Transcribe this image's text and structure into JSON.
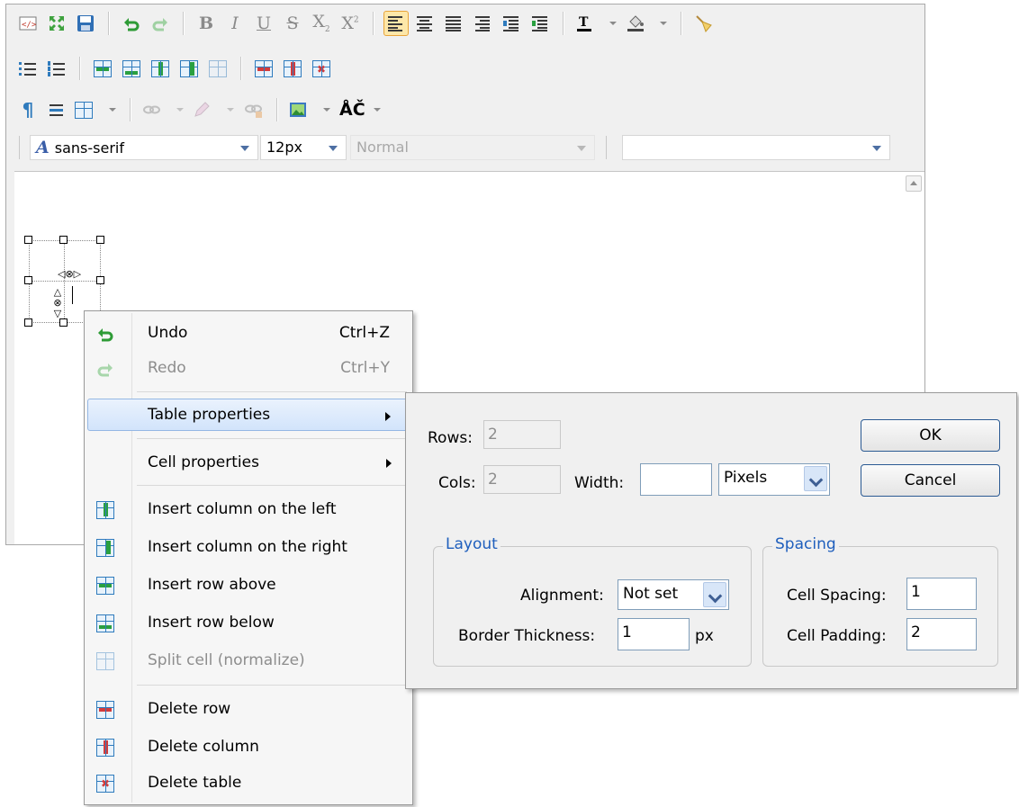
{
  "toolbar": {
    "row1_text": {
      "bold": "B",
      "italic": "I",
      "underline": "U",
      "strike": "S",
      "subscript": "X",
      "superscript": "X"
    },
    "row3_text": {
      "special_chars": "ÅČ"
    }
  },
  "font_bar": {
    "font_family": "sans-serif",
    "font_size": "12px",
    "format": "Normal",
    "style": ""
  },
  "context_menu": {
    "items": [
      {
        "label": "Undo",
        "shortcut": "Ctrl+Z"
      },
      {
        "label": "Redo",
        "shortcut": "Ctrl+Y"
      },
      {
        "label": "Table properties"
      },
      {
        "label": "Cell properties"
      },
      {
        "label": "Insert column on the left"
      },
      {
        "label": "Insert column on the right"
      },
      {
        "label": "Insert row above"
      },
      {
        "label": "Insert row below"
      },
      {
        "label": "Split cell (normalize)"
      },
      {
        "label": "Delete row"
      },
      {
        "label": "Delete column"
      },
      {
        "label": "Delete table"
      }
    ]
  },
  "table_properties": {
    "rows_label": "Rows:",
    "rows_value": "2",
    "cols_label": "Cols:",
    "cols_value": "2",
    "width_label": "Width:",
    "width_value": "",
    "width_unit": "Pixels",
    "ok_label": "OK",
    "cancel_label": "Cancel",
    "layout_legend": "Layout",
    "alignment_label": "Alignment:",
    "alignment_value": "Not set",
    "border_label": "Border Thickness:",
    "border_value": "1",
    "border_unit": "px",
    "spacing_legend": "Spacing",
    "cell_spacing_label": "Cell Spacing:",
    "cell_spacing_value": "1",
    "cell_padding_label": "Cell Padding:",
    "cell_padding_value": "2"
  },
  "colors": {
    "accent_blue": "#2f7bbd",
    "green_arrow": "#2aa040",
    "red_mark": "#d43b3b",
    "legend_blue": "#1f5fbd",
    "active_btn_bg": "#fde7a9"
  }
}
